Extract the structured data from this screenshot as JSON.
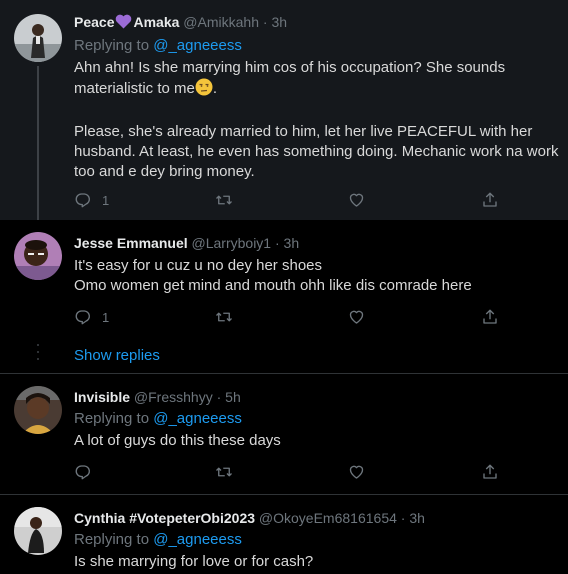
{
  "tweets": [
    {
      "name": "Peace",
      "name_suffix": "Amaka",
      "handle": "@Amikkahh",
      "time": "3h",
      "reply_prefix": "Replying to",
      "reply_to": "@_agneeess",
      "text_p1": "Ahn ahn! Is she marrying him cos of his occupation? She sounds materialistic to me",
      "text_p1_end": ".",
      "text_p2": "Please, she's already married to him, let her live PEACEFUL with her husband. At least, he even has something doing. Mechanic work na work too and e dey bring money.",
      "reply_count": "1",
      "emoji_icon": "unamused-face-emoji",
      "name_icon": "purple-heart-icon"
    },
    {
      "name": "Jesse Emmanuel",
      "handle": "@Larryboiy1",
      "time": "3h",
      "text_line1": "It's easy for u cuz u no dey her shoes",
      "text_line2": "Omo women get mind and mouth ohh like dis comrade here",
      "reply_count": "1"
    },
    {
      "name": "Invisible",
      "handle": "@Fresshhyy",
      "time": "5h",
      "reply_prefix": "Replying to",
      "reply_to": "@_agneeess",
      "text": "A lot of guys do this these days"
    },
    {
      "name": "Cynthia #VotepeterObi2023",
      "handle": "@OkoyeEm68161654",
      "time": "3h",
      "reply_prefix": "Replying to",
      "reply_to": "@_agneeess",
      "text": "Is she marrying for love or for cash?"
    }
  ],
  "show_replies": "Show replies",
  "separator": "·",
  "colors": {
    "background": "#000000",
    "highlight": "#15181c",
    "accent": "#1d9bf0",
    "muted": "#6e767d",
    "heart": "#9b6bd6"
  }
}
